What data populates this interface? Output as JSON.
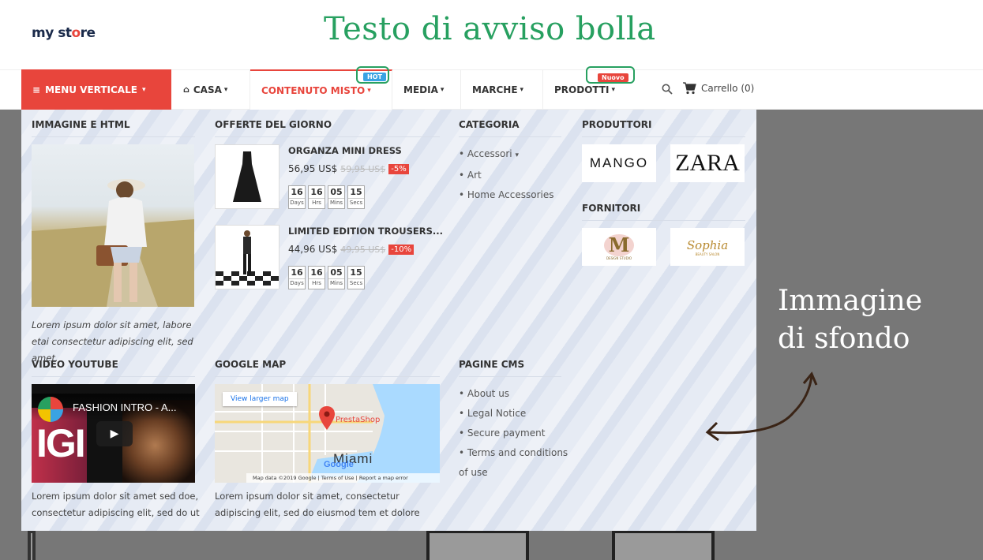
{
  "header": {
    "logo_part1": "my st",
    "logo_o": "o",
    "logo_part2": "re",
    "headline": "Testo di avviso bolla"
  },
  "nav": {
    "vertical_menu": "MENU VERTICALE",
    "items": [
      {
        "label": "CASA"
      },
      {
        "label": "CONTENUTO MISTO"
      },
      {
        "label": "MEDIA"
      },
      {
        "label": "MARCHE"
      },
      {
        "label": "PRODOTTI"
      }
    ],
    "badge_hot": "HOT",
    "badge_new": "Nuovo",
    "cart_label": "Carrello (0)"
  },
  "mega": {
    "image_html": {
      "title": "IMMAGINE E HTML",
      "caption": "Lorem ipsum dolor sit amet, labore etai consectetur adipiscing elit, sed amet."
    },
    "deals": {
      "title": "OFFERTE DEL GIORNO",
      "products": [
        {
          "name": "ORGANZA MINI DRESS",
          "price": "56,95 US$",
          "old_price": "59,95 US$",
          "discount": "-5%",
          "countdown": [
            {
              "n": "16",
              "l": "Days"
            },
            {
              "n": "16",
              "l": "Hrs"
            },
            {
              "n": "05",
              "l": "Mins"
            },
            {
              "n": "15",
              "l": "Secs"
            }
          ]
        },
        {
          "name": "LIMITED EDITION TROUSERS...",
          "price": "44,96 US$",
          "old_price": "49,95 US$",
          "discount": "-10%",
          "countdown": [
            {
              "n": "16",
              "l": "Days"
            },
            {
              "n": "16",
              "l": "Hrs"
            },
            {
              "n": "05",
              "l": "Mins"
            },
            {
              "n": "15",
              "l": "Secs"
            }
          ]
        }
      ]
    },
    "category": {
      "title": "CATEGORIA",
      "items": [
        "Accessori",
        "Art",
        "Home Accessories"
      ]
    },
    "producers": {
      "title": "PRODUTTORI",
      "brands": [
        "MANGO",
        "ZARA"
      ]
    },
    "suppliers": {
      "title": "FORNITORI",
      "brands": [
        "M",
        "DESIGN STUDIO",
        "Sophia",
        "BEAUTY SALON"
      ]
    },
    "video": {
      "title": "VIDEO YOUTUBE",
      "video_title": "FASHION INTRO - A...",
      "overlay_text": "IGI",
      "caption": "Lorem ipsum dolor sit amet sed doe, consectetur adipiscing elit, sed do ut"
    },
    "map": {
      "title": "GOOGLE MAP",
      "view_larger": "View larger map",
      "place": "PrestaShop",
      "city": "Miami",
      "brand": "Google",
      "footer": "Map data ©2019 Google | Terms of Use | Report a map error",
      "caption": "Lorem ipsum dolor sit amet, consectetur adipiscing elit, sed do eiusmod tem et dolore"
    },
    "cms": {
      "title": "PAGINE CMS",
      "items": [
        "About us",
        "Legal Notice",
        "Secure payment",
        "Terms and conditions of use"
      ]
    }
  },
  "annotation": {
    "line1": "Immagine",
    "line2": "di sfondo"
  },
  "colors": {
    "accent": "#e8453c",
    "headline": "#27a060",
    "callout": "#27a060",
    "hot_badge": "#3aa3e3"
  }
}
